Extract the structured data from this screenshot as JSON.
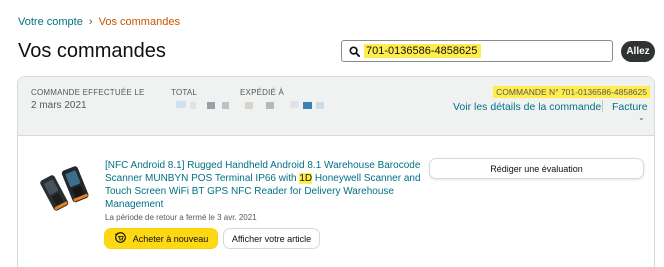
{
  "breadcrumb": {
    "parent": "Votre compte",
    "separator": "›",
    "current": "Vos commandes"
  },
  "page_title": "Vos commandes",
  "search": {
    "value": "701-0136586-4858625",
    "button_label": "Allez"
  },
  "order": {
    "placed_label": "COMMANDE EFFECTUÉE LE",
    "placed_date": "2 mars 2021",
    "total_label": "TOTAL",
    "ship_to_label": "EXPÉDIÉ À",
    "order_number": "COMMANDE N° 701-0136586-4858625",
    "details_link": "Voir les détails de la commande",
    "separator": "|",
    "invoice_link": "Facture",
    "invoice_chevron": "⌄",
    "item": {
      "title_part1": "[NFC Android 8.1] Rugged Handheld Android 8.1 Warehouse Barocode Scanner MUNBYN POS Terminal IP66 with ",
      "title_highlight": "1D",
      "title_part2": " Honeywell Scanner and Touch Screen WiFi BT GPS NFC Reader for Delivery Warehouse Management",
      "return_note": "La période de retour a fermé le 3 avr. 2021",
      "buy_again_label": "Acheter à nouveau",
      "view_item_label": "Afficher votre article",
      "review_label": "Rédiger une évaluation"
    }
  },
  "colors": {
    "link": "#007185",
    "highlight": "#ffec4d",
    "buy_again": "#ffd814",
    "breadcrumb_current": "#c45500"
  },
  "icons": [
    "search-icon",
    "buy-again-icon",
    "chevron-down-icon",
    "product-image"
  ]
}
